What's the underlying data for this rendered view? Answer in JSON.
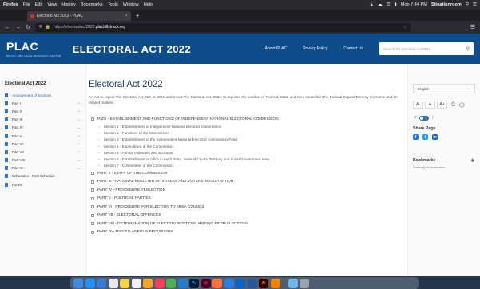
{
  "menubar": {
    "items": [
      "Firefox",
      "File",
      "Edit",
      "View",
      "History",
      "Bookmarks",
      "Tools",
      "Window",
      "Help"
    ],
    "clock": "Mon 7:44 PM",
    "user": "Situationroom"
  },
  "browser": {
    "tab_title": "Electoral Act 2022 - PLAC",
    "new_tab": "+",
    "url_prefix": "https://electoralact2022.",
    "url_host": "placbillstrack.org",
    "accent_color": "#ff7139"
  },
  "site": {
    "logo": "PLAC",
    "logo_sub": "POLICY AND LEGAL ADVOCACY CENTRE",
    "title": "ELECTORAL ACT 2022",
    "nav": [
      "About PLAC",
      "Privacy Policy",
      "Contact Us"
    ],
    "search_placeholder": "Search the Electoral Act 2022",
    "header_color": "#0f4c8a"
  },
  "sidebar": {
    "title": "Electoral Act 2022",
    "items": [
      {
        "label": "Arrangement of Sections",
        "active": true
      },
      {
        "label": "Part I"
      },
      {
        "label": "Part II"
      },
      {
        "label": "Part III"
      },
      {
        "label": "Part IV"
      },
      {
        "label": "Part V"
      },
      {
        "label": "Part VI"
      },
      {
        "label": "Part VII"
      },
      {
        "label": "Part VIII"
      },
      {
        "label": "Part IX"
      },
      {
        "label": "Schedules - First Schedule"
      },
      {
        "label": "Forms"
      }
    ]
  },
  "main": {
    "heading": "Electoral Act 2022",
    "intro": "An Act to repeal The Electoral Act, NO. 6, 2010 and enact The Electoral Act, 2022, to regulate the conduct of Federal, State and Area councils in the Federal Capital Territory elections; and for related matters.",
    "toc": [
      {
        "type": "part",
        "text": "Part I - ESTABLISHMENT AND FUNCTIONS OF INDEPENDENT NATIONAL ELECTORAL COMMISSION"
      },
      {
        "type": "sec",
        "text": "Section 1 - Establishment of Independent National Electoral Commission"
      },
      {
        "type": "sec",
        "text": "Section 2 - Functions of the Commission"
      },
      {
        "type": "sec",
        "text": "Section 3 - Establishment of the Independent National Electoral Commission Fund"
      },
      {
        "type": "sec",
        "text": "Section 4 - Expenditure of the Commission"
      },
      {
        "type": "sec",
        "text": "Section 5 - Annual estimates and accounts"
      },
      {
        "type": "sec",
        "text": "Section 6 - Establishment of office in each State, Federal Capital Territory and Local Government Area"
      },
      {
        "type": "sec",
        "text": "Section 7 - Committees of the Commission"
      },
      {
        "type": "part",
        "text": "PART II - STAFF OF THE COMMISSION"
      },
      {
        "type": "part",
        "text": "PART III - NATIONAL REGISTER OF VOTERS AND VOTERS' REGISTRATION"
      },
      {
        "type": "part",
        "text": "PART IV - PROCEDURE AT ELECTION"
      },
      {
        "type": "part",
        "text": "PART V - POLITICAL PARTIES"
      },
      {
        "type": "part",
        "text": "PART VI - PROCEDURE FOR ELECTION TO AREA COUNCIL"
      },
      {
        "type": "part",
        "text": "PART VII - ELECTORAL OFFENCES"
      },
      {
        "type": "part",
        "text": "PART VIII - DETERMINATION OF ELECTION PETITIONS ARISING FROM ELECTIONS"
      },
      {
        "type": "part",
        "text": "PART IX - MISCELLANEOUS PROVISIONS"
      }
    ]
  },
  "right_panel": {
    "language": "English",
    "font_sizes": [
      "A-",
      "A",
      "A+"
    ],
    "share_title": "Share Page",
    "bookmarks_title": "Bookmarks",
    "bookmarks_empty": "Currently no bookmarks"
  },
  "dock": {
    "icons": [
      "finder",
      "safari",
      "mail",
      "calendar",
      "notes",
      "reminders",
      "photos",
      "music",
      "chrome",
      "vscode",
      "photoshop",
      "indesign",
      "firefox",
      "keynote",
      "outlook",
      "word",
      "illustrator",
      "vlc",
      "preview",
      "trash"
    ],
    "labels": {
      "photoshop": "Ps",
      "indesign": "Id",
      "illustrator": "Ai"
    }
  }
}
